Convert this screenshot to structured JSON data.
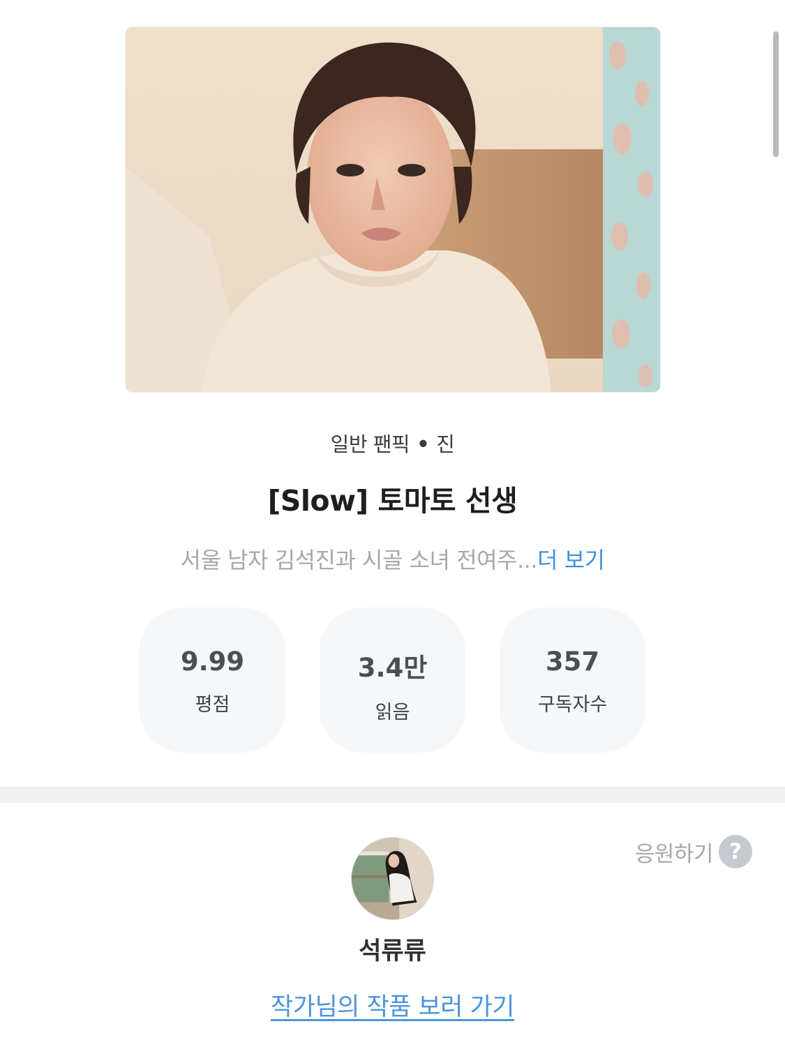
{
  "work": {
    "category": "일반 팬픽",
    "separator": "•",
    "character": "진",
    "title": "[Slow] 토마토 선생",
    "description": "서울 남자 김석진과 시골 소녀 전여주...",
    "more_label": "더 보기"
  },
  "stats": [
    {
      "value": "9.99",
      "label": "평점"
    },
    {
      "value": "3.4만",
      "label": "읽음"
    },
    {
      "value": "357",
      "label": "구독자수"
    }
  ],
  "support": {
    "label": "응원하기",
    "help_glyph": "?",
    "icon": "help-circle-icon"
  },
  "author": {
    "name": "석류류",
    "link_label": "작가님의 작품 보러 가기"
  },
  "colors": {
    "link": "#3d8fe0",
    "muted_text": "#a4a7ab",
    "stat_bg": "#f6f7f9",
    "divider": "#f0f1f3"
  }
}
